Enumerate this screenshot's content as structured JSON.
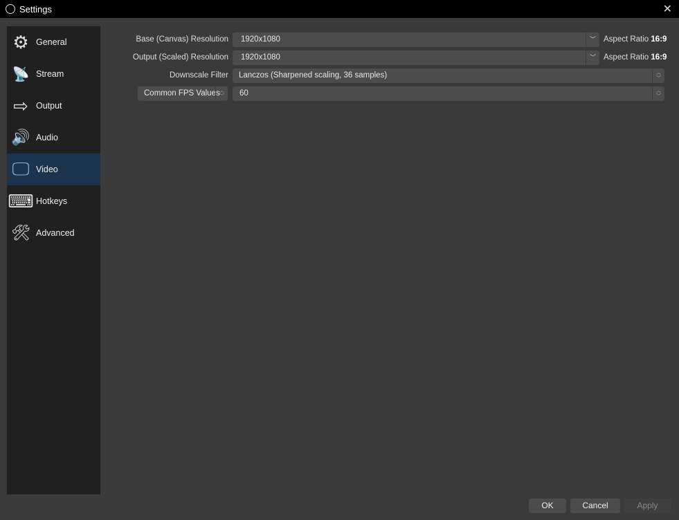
{
  "window": {
    "title": "Settings",
    "close": "✕"
  },
  "sidebar": {
    "items": [
      {
        "label": "General",
        "icon": "gear-icon",
        "glyph": "⚙"
      },
      {
        "label": "Stream",
        "icon": "broadcast-tower-icon",
        "glyph": "📡"
      },
      {
        "label": "Output",
        "icon": "monitor-arrow-icon",
        "glyph": "⇨"
      },
      {
        "label": "Audio",
        "icon": "speaker-icon",
        "glyph": "🔊"
      },
      {
        "label": "Video",
        "icon": "monitor-icon",
        "glyph": "🖵"
      },
      {
        "label": "Hotkeys",
        "icon": "keyboard-icon",
        "glyph": "⌨"
      },
      {
        "label": "Advanced",
        "icon": "tools-icon",
        "glyph": "🛠"
      }
    ],
    "selected": "Video"
  },
  "video": {
    "base_label": "Base (Canvas) Resolution",
    "base_value": "1920x1080",
    "output_label": "Output (Scaled) Resolution",
    "output_value": "1920x1080",
    "aspect_label": "Aspect Ratio",
    "base_aspect": "16:9",
    "output_aspect": "16:9",
    "downscale_label": "Downscale Filter",
    "downscale_value": "Lanczos (Sharpened scaling, 36 samples)",
    "fps_type": "Common FPS Values",
    "fps_value": "60"
  },
  "buttons": {
    "ok": "OK",
    "cancel": "Cancel",
    "apply": "Apply"
  }
}
